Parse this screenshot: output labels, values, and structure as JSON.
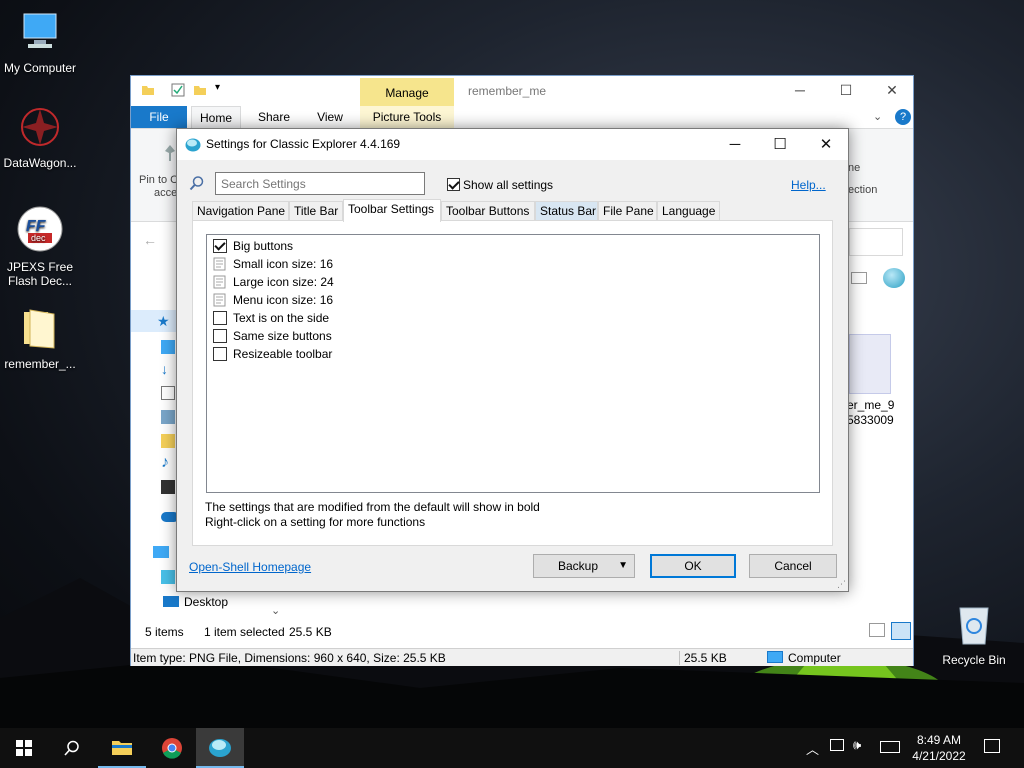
{
  "desktop": {
    "icons": [
      {
        "label": "My Computer"
      },
      {
        "label": "DataWagon..."
      },
      {
        "label": "JPEXS Free Flash Dec..."
      },
      {
        "label": "remember_..."
      },
      {
        "label": "Recycle Bin"
      }
    ]
  },
  "explorer": {
    "manage_tab": "Manage",
    "title": "remember_me",
    "tabs": {
      "file": "File",
      "home": "Home",
      "share": "Share",
      "view": "View",
      "picture_tools": "Picture Tools"
    },
    "ribbon_pin_text": "Pin to C",
    "ribbon_access_text": "acce",
    "ribbon_ne_text": "ne",
    "ribbon_ection_text": "ection",
    "thumb_name_line1": "er_me_9",
    "thumb_name_line2": "5833009",
    "sidebar_desktop": "Desktop",
    "status_items": "5 items",
    "status_selected": "1 item selected",
    "status_size": "25.5 KB",
    "details_text": "Item type: PNG File, Dimensions: 960 x 640, Size: 25.5 KB",
    "details_size": "25.5 KB",
    "details_location": "Computer"
  },
  "dialog": {
    "title": "Settings for Classic Explorer 4.4.169",
    "search_placeholder": "Search Settings",
    "show_all_label": "Show all settings",
    "show_all_checked": true,
    "help_link": "Help...",
    "tabs": [
      {
        "label": "Navigation Pane",
        "active": false
      },
      {
        "label": "Title Bar",
        "active": false
      },
      {
        "label": "Toolbar Settings",
        "active": true
      },
      {
        "label": "Toolbar Buttons",
        "active": false
      },
      {
        "label": "Status Bar",
        "active": false
      },
      {
        "label": "File Pane",
        "active": false
      },
      {
        "label": "Language",
        "active": false
      }
    ],
    "settings": [
      {
        "label": "Big buttons",
        "type": "checkbox",
        "checked": true
      },
      {
        "label": "Small icon size: 16",
        "type": "value"
      },
      {
        "label": "Large icon size: 24",
        "type": "value"
      },
      {
        "label": "Menu icon size: 16",
        "type": "value"
      },
      {
        "label": "Text is on the side",
        "type": "checkbox",
        "checked": false
      },
      {
        "label": "Same size buttons",
        "type": "checkbox",
        "checked": false
      },
      {
        "label": "Resizeable toolbar",
        "type": "checkbox",
        "checked": false
      }
    ],
    "info_line1": "The settings that are modified from the default will show in bold",
    "info_line2": "Right-click on a setting for more functions",
    "homepage_link": "Open-Shell Homepage",
    "backup_button": "Backup",
    "ok_button": "OK",
    "cancel_button": "Cancel"
  },
  "taskbar": {
    "time": "8:49 AM",
    "date": "4/21/2022"
  },
  "colors": {
    "accent": "#0078d7",
    "file_tab": "#1979ca",
    "manage_tab": "#f6e58d",
    "link": "#0066cc"
  }
}
